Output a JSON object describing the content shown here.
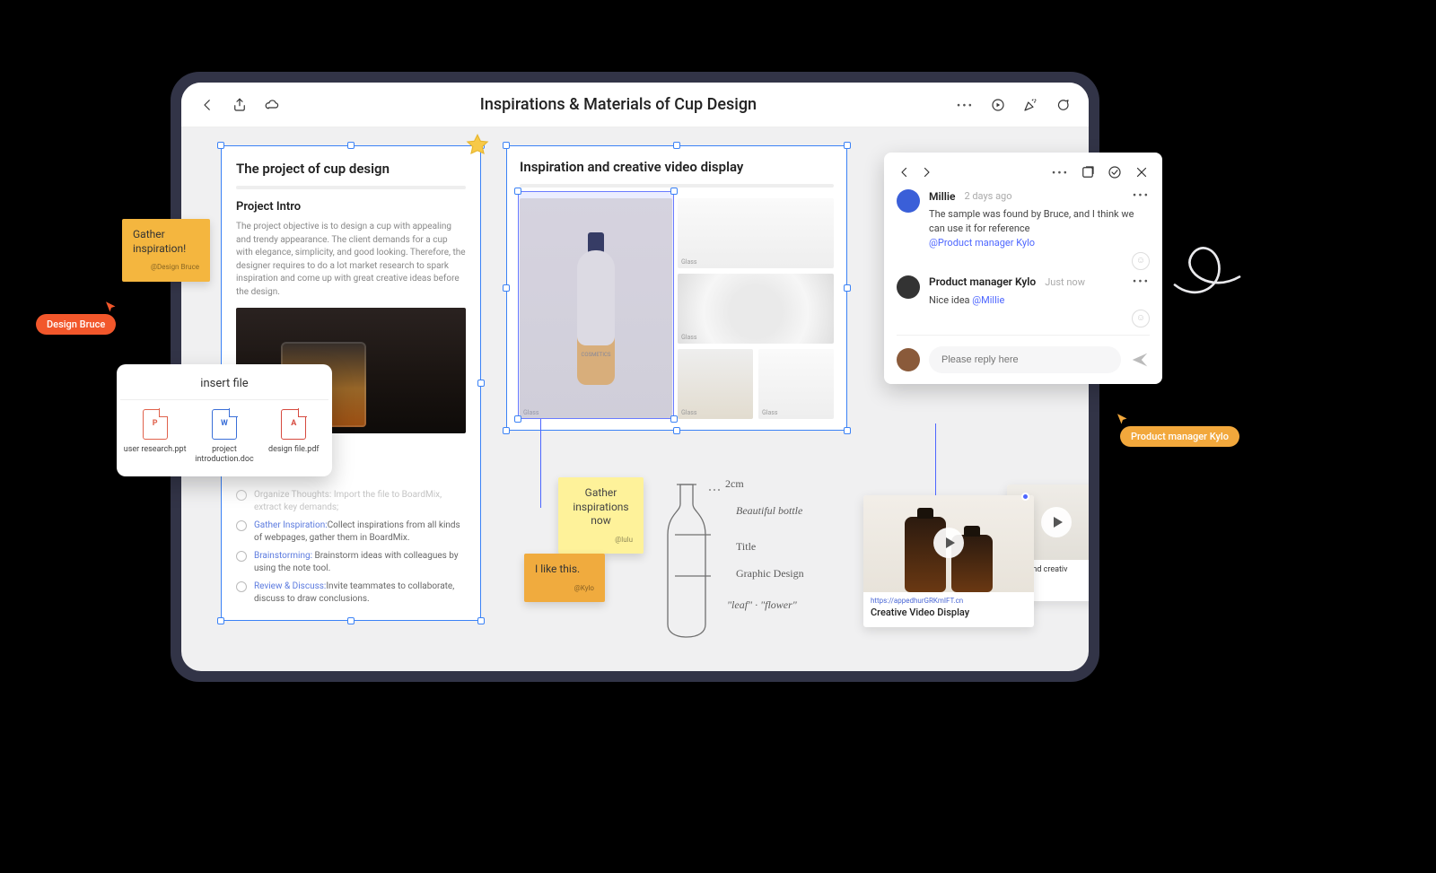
{
  "toolbar": {
    "title": "Inspirations & Materials of Cup Design"
  },
  "card1": {
    "title": "The project of cup design",
    "subtitle": "Project Intro",
    "intro": "The project objective is to design a cup with appealing and trendy appearance. The client demands for a cup with elegance, simplicity, and good looking. Therefore, the designer requires to do a lot market research to spark inspiration and come up with great creative ideas before the design.",
    "tasks": [
      {
        "done": true,
        "bold": "Organize Thoughts:",
        "rest": "Import the file to BoardMix, extract key demands;"
      },
      {
        "done": false,
        "bold": "Gather Inspiration:",
        "rest": "Collect inspirations from all kinds of webpages, gather them in BoardMix."
      },
      {
        "done": false,
        "bold": "Brainstorming:",
        "rest": "Brainstorm ideas with colleagues by using the note tool."
      },
      {
        "done": false,
        "bold": "Review & Discuss:",
        "rest": "Invite teammates to collaborate, discuss to draw conclusions."
      }
    ]
  },
  "card2": {
    "title": "Inspiration and creative video display",
    "tile_caption": "Glass"
  },
  "notes": {
    "n1": {
      "text": "Gather inspiration!",
      "author": "@Design Bruce"
    },
    "n2": {
      "text": "Gather inspirations now",
      "author": "@lulu"
    },
    "n3": {
      "text": "I like this.",
      "author": "@Kylo"
    }
  },
  "sketch": {
    "dim": "2cm",
    "line1": "Beautiful bottle",
    "line2": "Title",
    "line3": "Graphic Design",
    "line4": "\"leaf\" · \"flower\""
  },
  "video": {
    "url": "https://appedhurGRKmIFT.cn",
    "title": "Creative Video Display",
    "back_caption": "tion and creativ"
  },
  "insert": {
    "title": "insert file",
    "files": [
      {
        "glyph": "P",
        "label": "user research.ppt"
      },
      {
        "glyph": "W",
        "label": "project introduction.doc"
      },
      {
        "glyph": "A",
        "label": "design file.pdf"
      }
    ]
  },
  "cursors": {
    "bruce": "Design Bruce",
    "kylo": "Product manager Kylo"
  },
  "panel": {
    "comments": [
      {
        "name": "Millie",
        "time": "2 days ago",
        "body": "The sample was found by Bruce, and I think we can use it for reference",
        "mention": "@Product manager Kylo"
      },
      {
        "name": "Product manager Kylo",
        "time": "Just now",
        "body": "Nice idea ",
        "mention": "@Millie"
      }
    ],
    "reply_placeholder": "Please reply here"
  }
}
